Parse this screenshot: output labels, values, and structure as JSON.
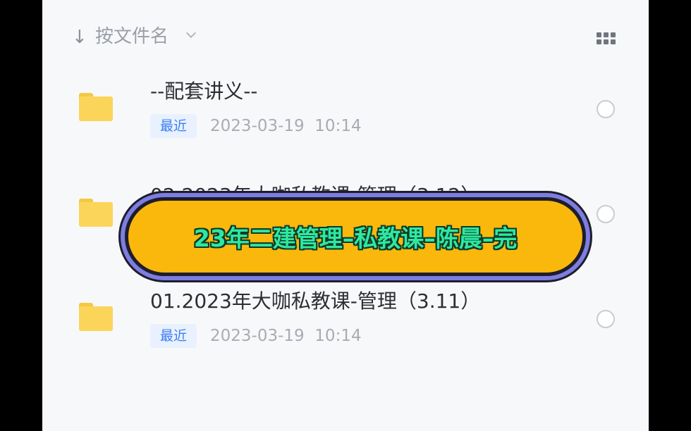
{
  "toolbar": {
    "sort_arrow": "↓",
    "sort_label": "按文件名",
    "sort_chevron_icon": "chevron-down-icon",
    "view_toggle_icon": "grid-view-icon"
  },
  "files": [
    {
      "name": "--配套讲义--",
      "badge": "最近",
      "date": "2023-03-19",
      "time": "10:14"
    },
    {
      "name": "02.2023年大咖私教课-管理（3.12）"
    },
    {
      "name": "01.2023年大咖私教课-管理（3.11）",
      "badge": "最近",
      "date": "2023-03-19",
      "time": "10:14"
    }
  ],
  "banner": {
    "text": "23年二建管理–私教课–陈晨–完"
  },
  "colors": {
    "folder": "#fbd55a",
    "badge_bg": "#e9f1fe",
    "badge_text": "#3b7ff2",
    "banner_fill": "#fbb80c",
    "banner_ring": "#7e7de0",
    "banner_text": "#2fe8a0"
  }
}
